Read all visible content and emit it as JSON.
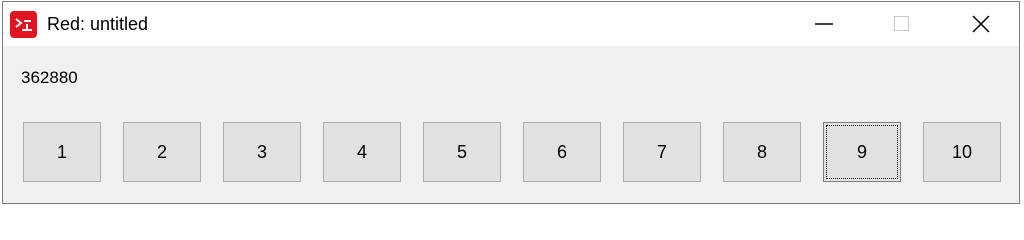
{
  "window": {
    "title": "Red: untitled",
    "app_icon": "red-logo-icon",
    "caption_buttons": [
      "minimize-icon",
      "maximize-icon",
      "close-icon"
    ]
  },
  "output": {
    "text": "362880"
  },
  "buttons": [
    {
      "label": "1"
    },
    {
      "label": "2"
    },
    {
      "label": "3"
    },
    {
      "label": "4"
    },
    {
      "label": "5"
    },
    {
      "label": "6"
    },
    {
      "label": "7"
    },
    {
      "label": "8"
    },
    {
      "label": "9",
      "focused": true
    },
    {
      "label": "10"
    }
  ],
  "colors": {
    "app_icon_red": "#e0141e",
    "client_background": "#f0f0f0",
    "button_face": "#e1e1e1"
  }
}
